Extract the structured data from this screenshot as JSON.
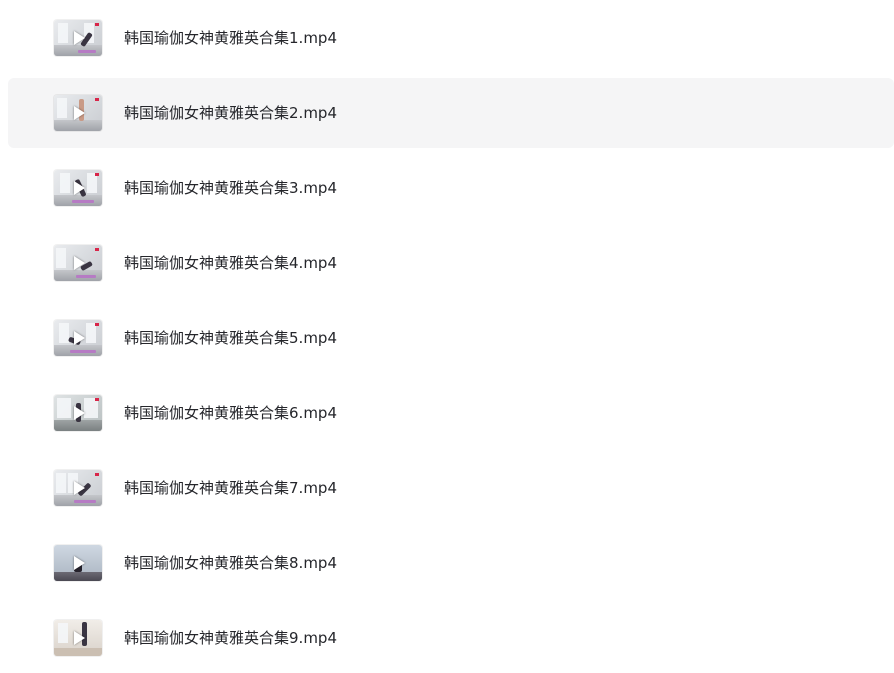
{
  "file_list": {
    "items": [
      {
        "name": "韩国瑜伽女神黄雅英合集1.mp4"
      },
      {
        "name": "韩国瑜伽女神黄雅英合集2.mp4"
      },
      {
        "name": "韩国瑜伽女神黄雅英合集3.mp4"
      },
      {
        "name": "韩国瑜伽女神黄雅英合集4.mp4"
      },
      {
        "name": "韩国瑜伽女神黄雅英合集5.mp4"
      },
      {
        "name": "韩国瑜伽女神黄雅英合集6.mp4"
      },
      {
        "name": "韩国瑜伽女神黄雅英合集7.mp4"
      },
      {
        "name": "韩国瑜伽女神黄雅英合集8.mp4"
      },
      {
        "name": "韩国瑜伽女神黄雅英合集9.mp4"
      }
    ],
    "hovered_index": 1
  },
  "colors": {
    "text": "#25262b",
    "row_hover_bg": "#f5f5f6",
    "play_icon": "#ffffff",
    "thumb_badge": "#d8264a"
  },
  "icons": {
    "thumbnail": "video-thumbnail",
    "play": "play-icon"
  }
}
